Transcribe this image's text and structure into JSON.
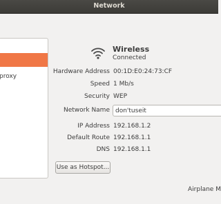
{
  "window": {
    "title": "Network"
  },
  "sidebar": {
    "items": [
      {
        "label": ""
      },
      {
        "label": "proxy"
      }
    ]
  },
  "connection": {
    "name": "Wireless",
    "status": "Connected",
    "icon": "wifi-signal-icon"
  },
  "details": {
    "hardware_address": {
      "label": "Hardware Address",
      "value": "00:1D:E0:24:73:CF"
    },
    "speed": {
      "label": "Speed",
      "value": "1 Mb/s"
    },
    "security": {
      "label": "Security",
      "value": "WEP"
    },
    "network_name": {
      "label": "Network Name",
      "value": "don'tuseit"
    },
    "ip_address": {
      "label": "IP Address",
      "value": "192.168.1.2"
    },
    "default_route": {
      "label": "Default Route",
      "value": "192.168.1.1"
    },
    "dns": {
      "label": "DNS",
      "value": "192.168.1.1"
    }
  },
  "actions": {
    "hotspot_label": "Use as Hotspot..."
  },
  "footer": {
    "airplane_label": "Airplane M"
  },
  "colors": {
    "selection": "#f07746",
    "titlebar": "#3c3b37",
    "background": "#f2f1f0"
  }
}
